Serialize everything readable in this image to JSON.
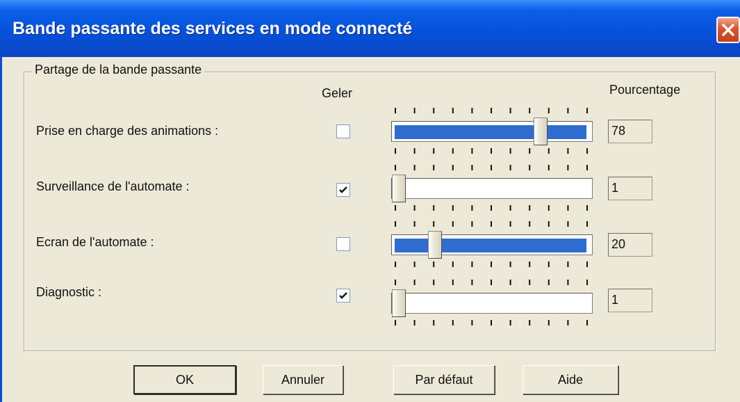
{
  "window": {
    "title": "Bande passante des services en mode connecté"
  },
  "group": {
    "legend": "Partage de la bande passante"
  },
  "columns": {
    "freeze": "Geler",
    "percentage": "Pourcentage"
  },
  "rows": [
    {
      "label": "Prise en charge des animations :",
      "frozen": false,
      "value": 78,
      "value_text": "78"
    },
    {
      "label": "Surveillance de l'automate :",
      "frozen": true,
      "value": 1,
      "value_text": "1"
    },
    {
      "label": "Ecran de l'automate :",
      "frozen": false,
      "value": 20,
      "value_text": "20"
    },
    {
      "label": "Diagnostic :",
      "frozen": true,
      "value": 1,
      "value_text": "1"
    }
  ],
  "buttons": {
    "ok": "OK",
    "cancel": "Annuler",
    "default": "Par défaut",
    "help": "Aide"
  },
  "colors": {
    "title_bar": "#0650d8",
    "slider_fill": "#2f6ccf",
    "dialog_bg": "#ece9d8",
    "close_button": "#d9542e"
  },
  "icons": {
    "close": "close-icon",
    "check": "checkmark-icon"
  }
}
